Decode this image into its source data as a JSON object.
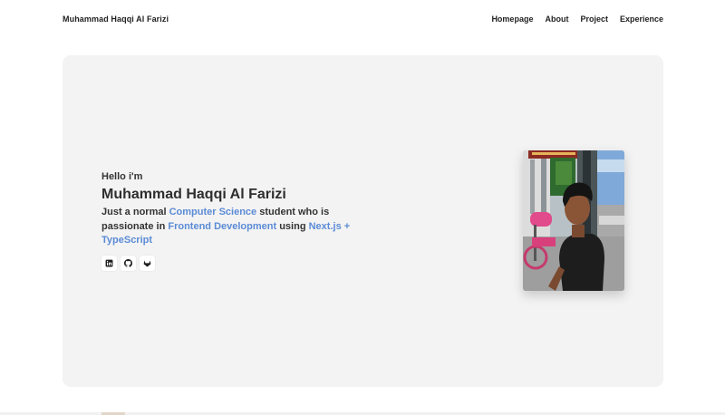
{
  "navbar": {
    "brand": "Muhammad Haqqi Al Farizi",
    "links": [
      "Homepage",
      "About",
      "Project",
      "Experience"
    ]
  },
  "hero": {
    "greeting": "Hello i'm",
    "name": "Muhammad Haqqi Al Farizi",
    "tagline": {
      "part1": "Just a normal ",
      "highlight1": "Computer Science",
      "part2": " student who is passionate in ",
      "highlight2": "Frontend Development",
      "part3": " using ",
      "highlight3": "Next.js + TypeScript"
    },
    "socials": [
      {
        "icon": "linkedin-icon"
      },
      {
        "icon": "github-icon"
      },
      {
        "icon": "gitlab-icon"
      }
    ],
    "photo": {
      "alt": "portrait-photo"
    }
  },
  "colors": {
    "accent": "#5b8bd6",
    "hero_background": "#f3f3f3",
    "text": "#2e2e2e"
  }
}
